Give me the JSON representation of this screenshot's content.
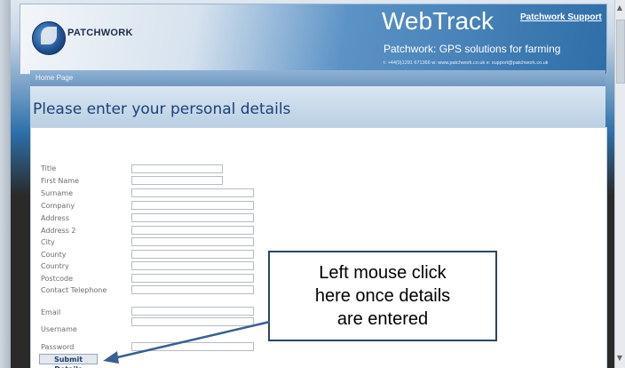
{
  "header": {
    "logo_text": "PATCHWORK",
    "brand": "WebTrack",
    "support_link": "Patchwork Support",
    "tagline": "Patchwork: GPS solutions for farming",
    "contact": "t: +44(0)1291 671366   w: www.patchwork.co.uk   e: support@patchwork.co.uk"
  },
  "nav": {
    "home": "Home Page"
  },
  "page_title": "Please enter your personal details",
  "form": {
    "title": "Title",
    "first_name": "First Name",
    "surname": "Surname",
    "company": "Company",
    "address": "Address",
    "address2": "Address 2",
    "city": "City",
    "county": "County",
    "country": "Country",
    "postcode": "Postcode",
    "telephone": "Contact Telephone",
    "email": "Email",
    "username": "Username",
    "password": "Password",
    "submit": "Submit Details"
  },
  "callout": {
    "line1": "Left mouse click",
    "line2": "here once details",
    "line3": "are entered"
  },
  "colors": {
    "accent": "#1c3f78",
    "callout_border": "#2a4466",
    "arrow": "#3a5f95"
  }
}
